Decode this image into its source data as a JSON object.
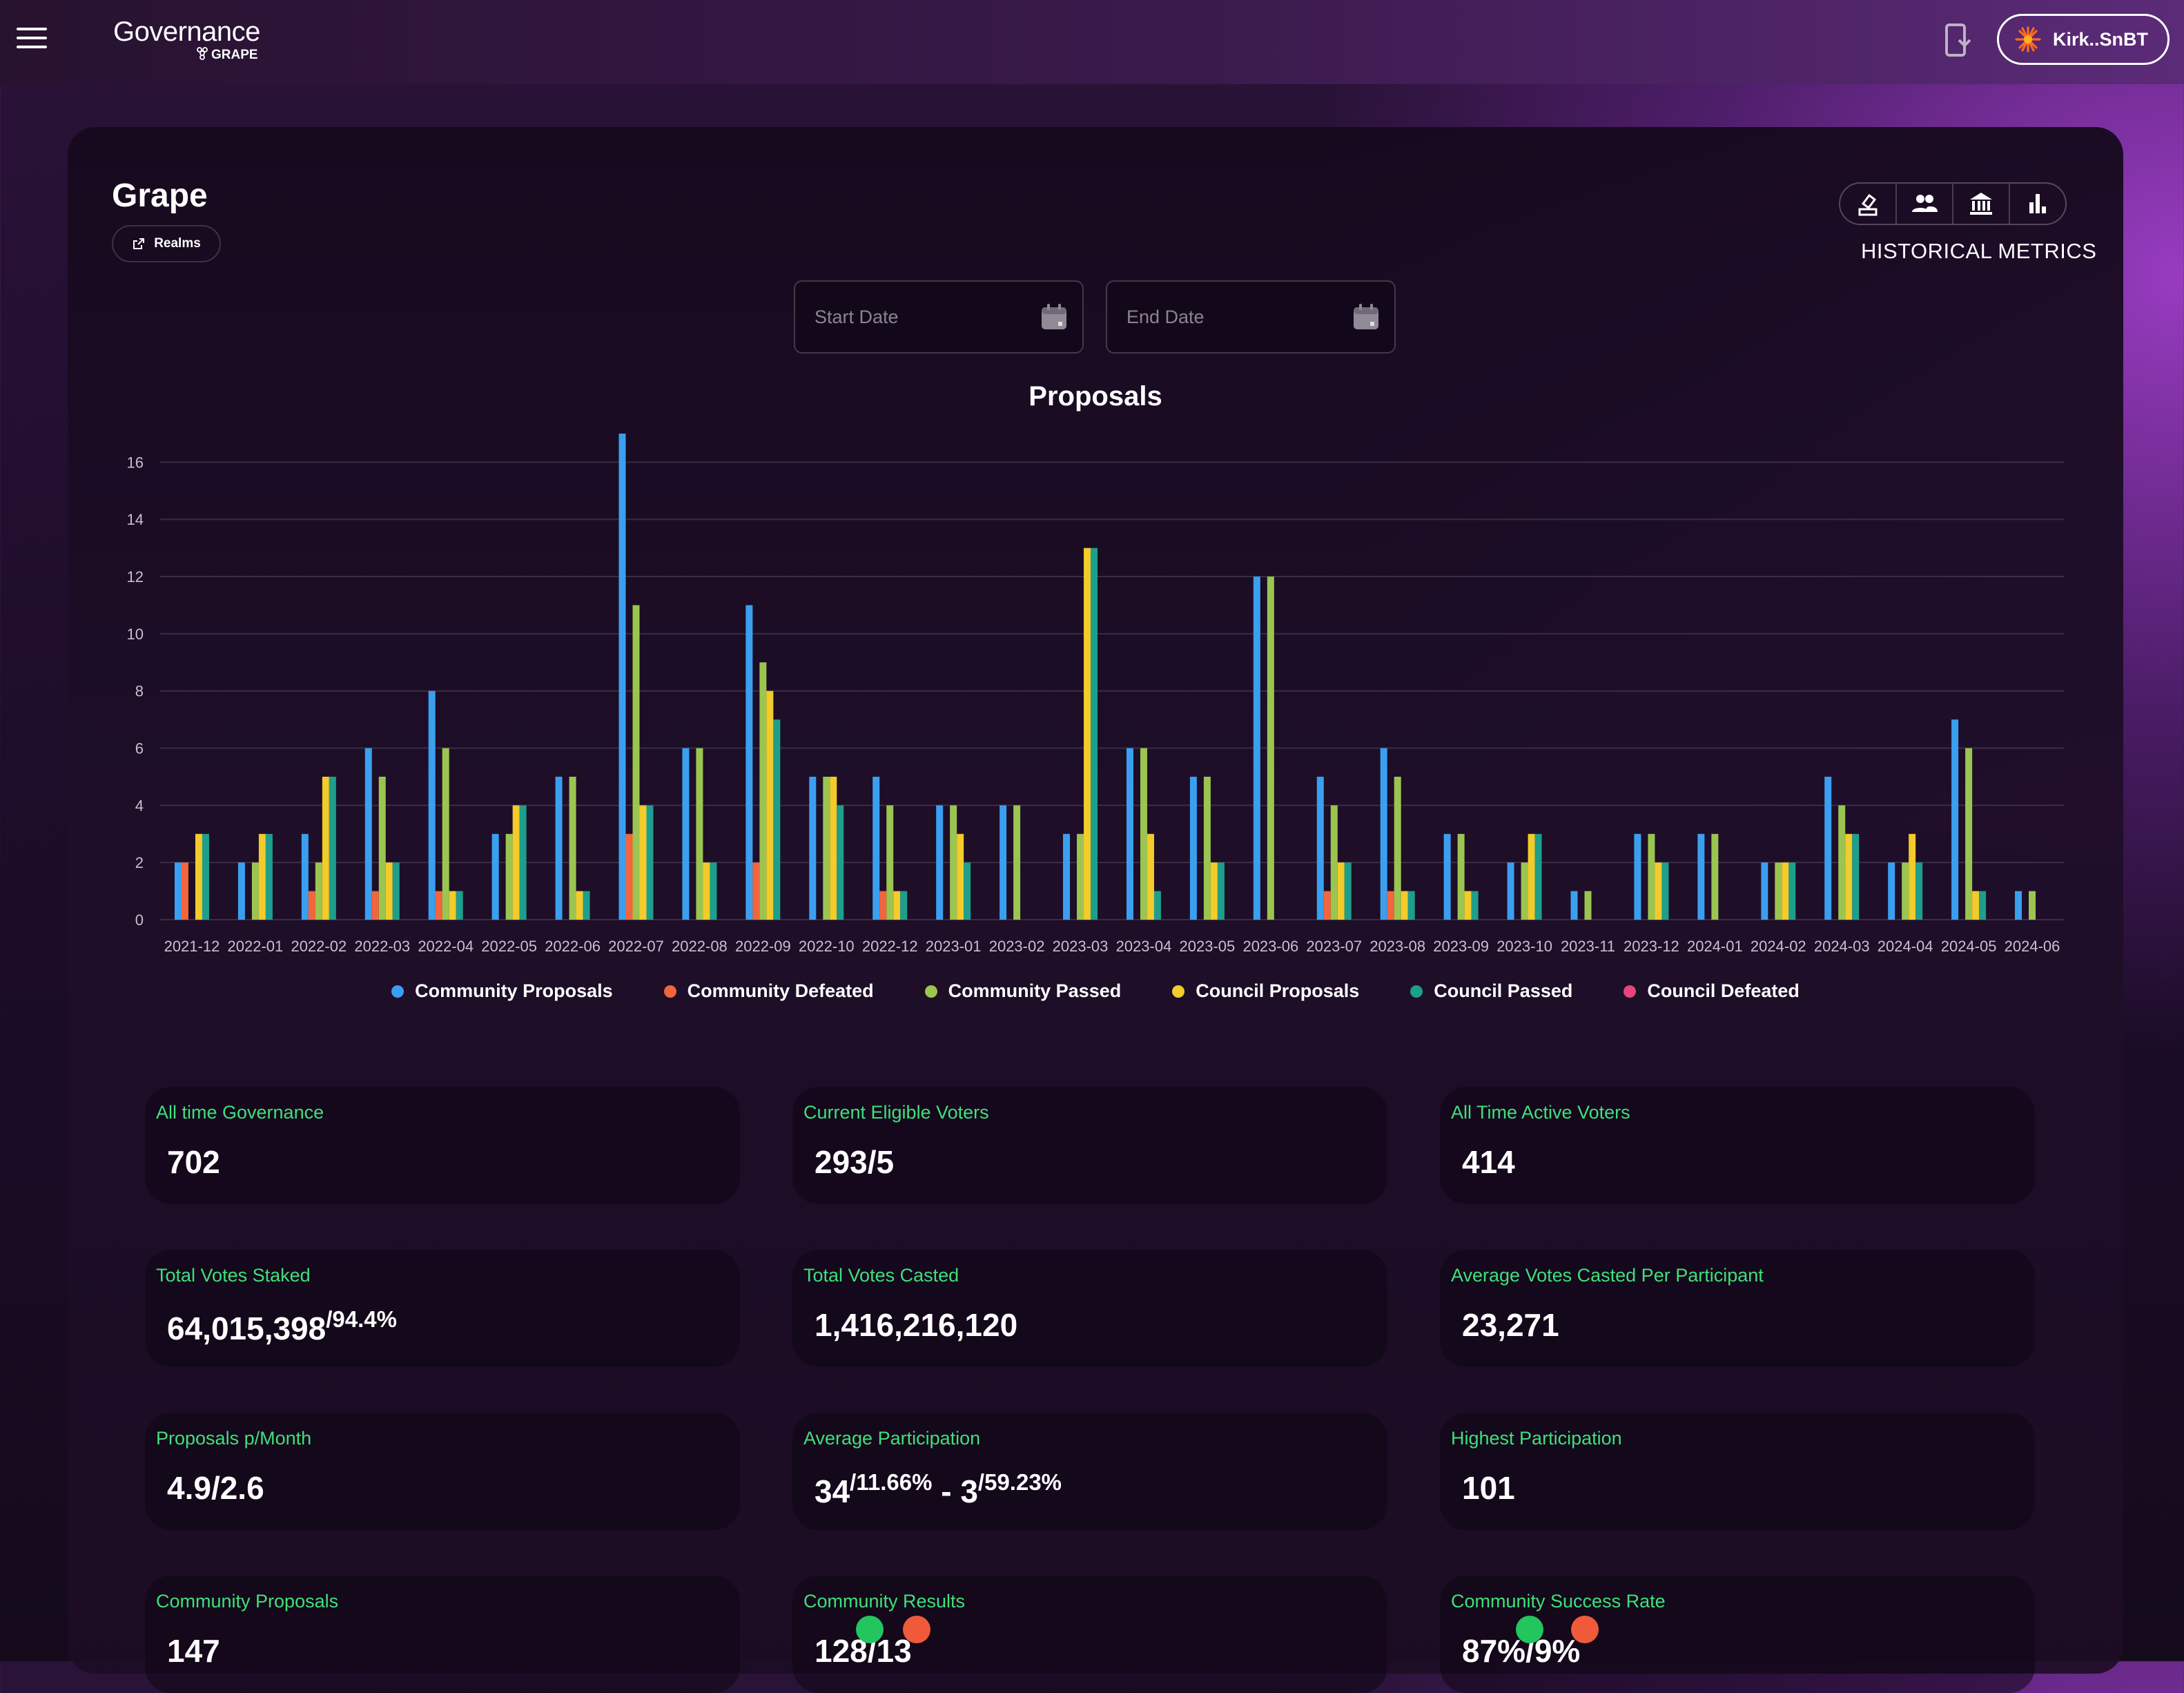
{
  "header": {
    "brand": "Governance",
    "brand_sub": "GRAPE",
    "wallet_label": "Kirk..SnBT",
    "colors": {
      "accent": "#8e3fc0",
      "spark": "#ff6a1f"
    }
  },
  "realm": {
    "title": "Grape",
    "realms_button": "Realms",
    "toolbar": [
      "ballot-icon",
      "people-icon",
      "treasury-icon",
      "metrics-icon"
    ],
    "historical_label": "HISTORICAL METRICS"
  },
  "filters": {
    "start_placeholder": "Start Date",
    "end_placeholder": "End Date"
  },
  "chart_data": {
    "type": "bar",
    "title": "Proposals",
    "ylim": [
      0,
      17
    ],
    "y_ticks": [
      0,
      2,
      4,
      6,
      8,
      10,
      12,
      14,
      16
    ],
    "grid": true,
    "legend_position": "bottom",
    "categories": [
      "2021-12",
      "2022-01",
      "2022-02",
      "2022-03",
      "2022-04",
      "2022-05",
      "2022-06",
      "2022-07",
      "2022-08",
      "2022-09",
      "2022-10",
      "2022-12",
      "2023-01",
      "2023-02",
      "2023-03",
      "2023-04",
      "2023-05",
      "2023-06",
      "2023-07",
      "2023-08",
      "2023-09",
      "2023-10",
      "2023-11",
      "2023-12",
      "2024-01",
      "2024-02",
      "2024-03",
      "2024-04",
      "2024-05",
      "2024-06"
    ],
    "series": [
      {
        "name": "Community Proposals",
        "color": "#3b9ff0",
        "values": [
          2,
          2,
          3,
          6,
          8,
          3,
          5,
          17,
          6,
          11,
          5,
          5,
          4,
          4,
          3,
          6,
          5,
          12,
          5,
          6,
          3,
          2,
          1,
          3,
          3,
          2,
          5,
          2,
          7,
          1
        ]
      },
      {
        "name": "Community Defeated",
        "color": "#f2653d",
        "values": [
          2,
          0,
          1,
          1,
          1,
          0,
          0,
          3,
          0,
          2,
          0,
          1,
          0,
          0,
          0,
          0,
          0,
          0,
          1,
          1,
          0,
          0,
          0,
          0,
          0,
          0,
          0,
          0,
          0,
          0
        ]
      },
      {
        "name": "Community Passed",
        "color": "#9bc550",
        "values": [
          0,
          2,
          2,
          5,
          6,
          3,
          5,
          11,
          6,
          9,
          5,
          4,
          4,
          4,
          3,
          6,
          5,
          12,
          4,
          5,
          3,
          2,
          1,
          3,
          3,
          2,
          4,
          2,
          6,
          1
        ]
      },
      {
        "name": "Council Proposals",
        "color": "#f3cb2a",
        "values": [
          3,
          3,
          5,
          2,
          1,
          4,
          1,
          4,
          2,
          8,
          5,
          1,
          3,
          0,
          13,
          3,
          2,
          0,
          2,
          1,
          1,
          3,
          0,
          2,
          0,
          2,
          3,
          3,
          1,
          0
        ]
      },
      {
        "name": "Council Passed",
        "color": "#1e9e8c",
        "values": [
          3,
          3,
          5,
          2,
          1,
          4,
          1,
          4,
          2,
          7,
          4,
          1,
          2,
          0,
          13,
          1,
          2,
          0,
          2,
          1,
          1,
          3,
          0,
          2,
          0,
          2,
          3,
          2,
          1,
          0
        ]
      },
      {
        "name": "Council Defeated",
        "color": "#e5457a",
        "values": [
          0,
          0,
          0,
          0,
          0,
          0,
          0,
          0,
          0,
          0,
          0,
          0,
          0,
          0,
          0,
          0,
          0,
          0,
          0,
          0,
          0,
          0,
          0,
          0,
          0,
          0,
          0,
          0,
          0,
          0
        ]
      }
    ]
  },
  "metrics": [
    {
      "label": "All time Governance",
      "value": "702",
      "sup": ""
    },
    {
      "label": "Current Eligible Voters",
      "value": "293/5",
      "sup": ""
    },
    {
      "label": "All Time Active Voters",
      "value": "414",
      "sup": ""
    },
    {
      "label": "Total Votes Staked",
      "value": "64,015,398",
      "sup": "/94.4%"
    },
    {
      "label": "Total Votes Casted",
      "value": "1,416,216,120",
      "sup": ""
    },
    {
      "label": "Average Votes Casted Per Participant",
      "value": "23,271",
      "sup": ""
    },
    {
      "label": "Proposals p/Month",
      "value": "4.9/2.6",
      "sup": ""
    },
    {
      "label": "Average Participation",
      "value": "34",
      "sup": "/11.66%",
      "value2": " - 3",
      "sup2": "/59.23%"
    },
    {
      "label": "Highest Participation",
      "value": "101",
      "sup": ""
    },
    {
      "label": "Community Proposals",
      "value": "147",
      "sup": ""
    },
    {
      "label": "Community Results",
      "value": "128/13",
      "sup": ""
    },
    {
      "label": "Community Success Rate",
      "value": "87%/9%",
      "sup": ""
    }
  ]
}
